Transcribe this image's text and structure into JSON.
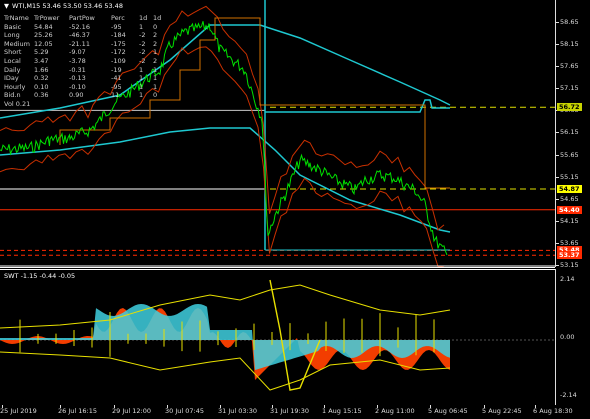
{
  "window": {
    "title": "WTI,M15  53.46 53.50 53.46 53.48",
    "indicator_label": "SWT -1.15 -0.44 -0.05"
  },
  "table": {
    "header": [
      "TrName",
      "TrPower",
      "PartPow",
      "Perc",
      "1d",
      "1d"
    ],
    "rows": [
      [
        "Basic",
        "54.84",
        "-52.16",
        "-95",
        "1",
        "0"
      ],
      [
        "Long",
        "25.26",
        "-46.37",
        "-184",
        "-2",
        "2"
      ],
      [
        "Medium",
        "12.05",
        "-21.11",
        "-175",
        "-2",
        "2"
      ],
      [
        "Short",
        "5.29",
        "-9.07",
        "-172",
        "-2",
        "1"
      ],
      [
        "Local",
        "3.47",
        "-3.78",
        "-109",
        "-2",
        "2"
      ],
      [
        "Daily",
        "1.66",
        "-0.31",
        "-19",
        "1",
        "1"
      ],
      [
        "IDay",
        "0.32",
        "-0.13",
        "-41",
        "1",
        "1"
      ],
      [
        "Hourly",
        "0.10",
        "-0.10",
        "-95",
        "1",
        "1"
      ],
      [
        "Bid.n",
        "0.36",
        "0.90",
        "11",
        "1",
        "0"
      ]
    ],
    "footer": "Vol 0.21"
  },
  "price_scale": {
    "ticks": [
      "58.65",
      "58.15",
      "57.65",
      "57.15",
      "56.65",
      "56.15",
      "55.65",
      "55.15",
      "54.65",
      "54.15",
      "53.65",
      "53.15"
    ],
    "badges": [
      {
        "label": "56.72",
        "color": "#c8d400",
        "text_color": "#000"
      },
      {
        "label": "54.87",
        "color": "#ffff00",
        "text_color": "#000"
      },
      {
        "label": "54.40",
        "color": "#ff2a00",
        "text_color": "#fff"
      },
      {
        "label": "53.48",
        "color": "#ff2a00",
        "text_color": "#fff"
      },
      {
        "label": "53.37",
        "color": "#ff2a00",
        "text_color": "#fff"
      }
    ]
  },
  "sub_scale": {
    "ticks": [
      "2.14",
      "0.00",
      "-2.14"
    ]
  },
  "time_axis": {
    "labels": [
      "25 Jul 2019",
      "26 Jul 16:15",
      "29 Jul 12:00",
      "30 Jul 07:45",
      "31 Jul 03:30",
      "31 Jul 19:30",
      "1 Aug 15:15",
      "2 Aug 11:00",
      "5 Aug 06:45",
      "5 Aug 22:45",
      "6 Aug 18:30"
    ]
  },
  "colors": {
    "price_line": "#00e000",
    "ma_cyan": "#1ec8d0",
    "envelope": "#c83000",
    "step_line": "#d07000",
    "level_yellow": "#e0e000",
    "level_red": "#ff2a00",
    "hist_orange": "#ff4000",
    "hist_cyan": "#40d0e0",
    "hist_yellow": "#e8e000"
  }
}
